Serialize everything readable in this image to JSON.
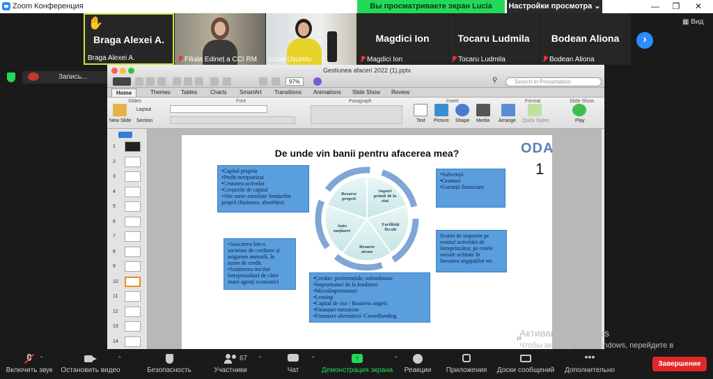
{
  "window": {
    "title": "Zoom Конференция"
  },
  "share_banner": "Вы просматриваете экран Lucia Usurelu",
  "view_options": "Настройки просмотра ⌄",
  "view_button": "Вид",
  "recording": "Запись...",
  "participants_tiles": [
    {
      "big_name": "Braga Alexei A.",
      "name": "Braga Alexei A.",
      "muted": false,
      "hand": "✋"
    },
    {
      "big_name": "",
      "name": "Filiala Edineț a CCI RM",
      "muted": true
    },
    {
      "big_name": "",
      "name": "Lucia Usurelu",
      "muted": false
    },
    {
      "big_name": "Magdici Ion",
      "name": "Magdici Ion",
      "muted": true
    },
    {
      "big_name": "Tocaru Ludmila",
      "name": "Tocaru Ludmila",
      "muted": true
    },
    {
      "big_name": "Bodean Aliona",
      "name": "Bodean Aliona",
      "muted": true
    }
  ],
  "ppt": {
    "filename": "Gestiunea afaceri 2022 (1).pptx",
    "zoom": "97%",
    "search_placeholder": "Search in Presentation",
    "tabs": [
      "Home",
      "Themes",
      "Tables",
      "Charts",
      "SmartArt",
      "Transitions",
      "Animations",
      "Slide Show",
      "Review"
    ],
    "groups": [
      "Slides",
      "Font",
      "Paragraph",
      "Insert",
      "Format",
      "Slide Show"
    ],
    "buttons": {
      "new_slide": "New Slide",
      "layout": "Layout",
      "section": "Section",
      "text": "Text",
      "picture": "Picture",
      "shape": "Shape",
      "media": "Media",
      "arrange": "Arrange",
      "quick_styles": "Quick Styles",
      "play": "Play"
    },
    "thumb_numbers": [
      "1",
      "2",
      "3",
      "4",
      "5",
      "6",
      "7",
      "8",
      "9",
      "10",
      "11",
      "12",
      "13",
      "14"
    ]
  },
  "slide": {
    "title": "De unde vin banii pentru afacerea mea?",
    "logo": "ODA",
    "number": "1",
    "box_left_top": [
      "•Capital propriu",
      "•Profit nerepartizat",
      "•Cesiunea activelor",
      "•Creșterile de capital",
      "•Alte surse asimilate fondurilor",
      " proprii (fuziunea, absorbția)"
    ],
    "box_right_top": [
      "•Subvenții",
      "•Granturi",
      "•Garanții financiare"
    ],
    "box_left_mid": [
      "•Asocierea într-o",
      " societate de creditare și",
      " asigurare mutuală, în",
      " nume de credit.",
      "",
      "•Susținerea micilor",
      " întreprinzători de către",
      " marii agenți economici"
    ],
    "box_right_mid": [
      "Scutiri de impozite pe",
      "venitul activității de",
      "întreprinzător, pe cotele",
      "sociale achitate în",
      "favoarea angajaților etc."
    ],
    "box_bottom": [
      "•Credite: preferențiale, subordonate",
      "•Împrumuturi de la fondatori",
      "•Microîmprumuturi",
      "•Leasing",
      "•Capital de risc / Business angels",
      "•Finanțare mezanine",
      "•Finanțare alternativă /Crowdfunding"
    ],
    "cycle": {
      "top_left": [
        "Resurse",
        "proprii"
      ],
      "top_right": [
        "Suport",
        "primit de la",
        "stat"
      ],
      "right": [
        "Facilități",
        "fiscale"
      ],
      "bottom": [
        "Resurse",
        "atrase"
      ],
      "left": [
        "Auto",
        "susținere"
      ]
    },
    "page_mark": "10"
  },
  "activation": {
    "line1": "Активация Windows",
    "line2": "Чтобы активировать Windows, перейдите в раздел \"Параметры\"."
  },
  "toolbar": {
    "mute": "Включить звук",
    "video": "Остановить видео",
    "security": "Безопасность",
    "participants": "Участники",
    "participants_count": "67",
    "chat": "Чат",
    "share": "Демонстрация экрана",
    "reactions": "Реакции",
    "apps": "Приложения",
    "whiteboard": "Доски сообщений",
    "more": "Дополнительно",
    "end": "Завершение"
  },
  "colors": {
    "zoom_blue": "#2d8cff",
    "share_green": "#23d959",
    "end_red": "#e02828",
    "box_blue": "#5a9ede"
  }
}
